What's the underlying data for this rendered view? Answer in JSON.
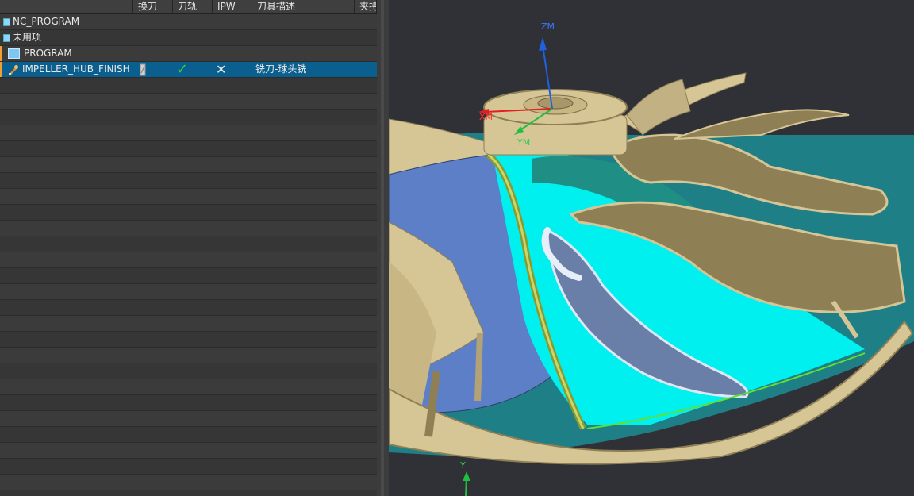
{
  "columns": [
    "",
    "换刀",
    "刀轨",
    "IPW",
    "刀具描述",
    "夹持"
  ],
  "tree": [
    {
      "label": "NC_PROGRAM",
      "icon": "program-root-icon"
    },
    {
      "label": "未用项",
      "icon": "unused-items-icon"
    },
    {
      "label": "PROGRAM",
      "icon": "folder-icon"
    },
    {
      "label": "IMPELLER_HUB_FINISH",
      "icon": "operation-icon",
      "tool_change": "tool-change-icon",
      "toolpath": "✓",
      "ipw": "✕",
      "tool_desc": "铣刀-球头铣"
    }
  ],
  "viewport": {
    "axes": {
      "zm": "ZM",
      "xm": "XM",
      "ym": "YM",
      "y": "Y"
    }
  }
}
